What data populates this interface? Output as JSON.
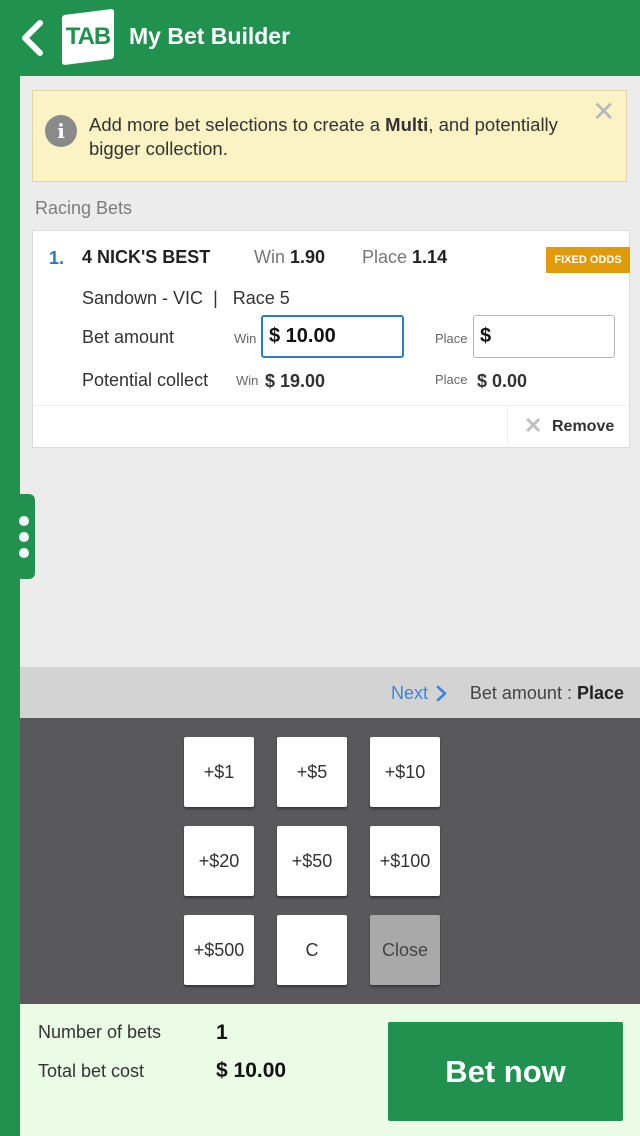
{
  "header": {
    "logo_text": "TAB",
    "title": "My Bet Builder"
  },
  "notice": {
    "text_before": "Add more bet selections to create a ",
    "text_bold": "Multi",
    "text_after": ", and potentially bigger collection.",
    "close_symbol": "✕"
  },
  "section_title": "Racing Bets",
  "bet": {
    "number": "1.",
    "runner": "4 NICK'S BEST",
    "win_label": "Win",
    "win_odds": "1.90",
    "place_label": "Place",
    "place_odds": "1.14",
    "badge": "FIXED ODDS",
    "meeting": "Sandown - VIC  |   Race 5",
    "bet_amount_label": "Bet amount",
    "win_small": "Win",
    "win_amount": "$ 10.00",
    "place_small": "Place",
    "place_amount": "$",
    "potential_collect_label": "Potential collect",
    "win_collect": "$ 19.00",
    "place_collect": "$ 0.00",
    "remove_label": "Remove"
  },
  "keypad_bar": {
    "next_label": "Next",
    "bet_amount_prefix": "Bet amount : ",
    "bet_amount_target": "Place"
  },
  "keypad": {
    "keys": [
      "+$1",
      "+$5",
      "+$10",
      "+$20",
      "+$50",
      "+$100",
      "+$500",
      "C",
      "Close"
    ]
  },
  "footer": {
    "number_of_bets_label": "Number of bets",
    "number_of_bets": "1",
    "total_cost_label": "Total bet cost",
    "total_cost": "$ 10.00",
    "bet_now_label": "Bet now"
  },
  "colors": {
    "brand_green": "#219150",
    "accent_blue": "#2f7bc4",
    "badge_orange": "#e09b0b",
    "notice_yellow": "#fbf3c4"
  }
}
